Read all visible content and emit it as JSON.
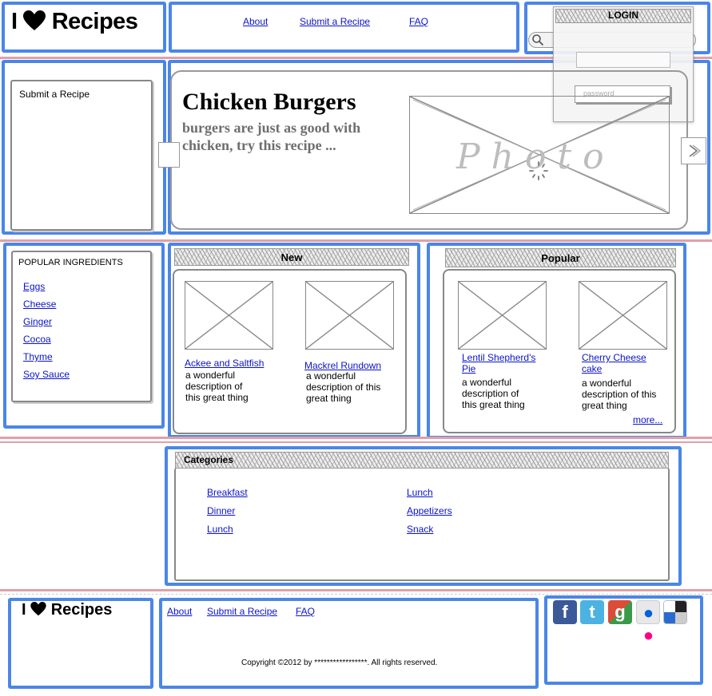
{
  "header": {
    "logo_prefix": "I",
    "logo_word": "Recipes",
    "nav": [
      {
        "label": "About"
      },
      {
        "label": "Submit a Recipe"
      },
      {
        "label": "FAQ"
      }
    ]
  },
  "login": {
    "title": "LOGIN",
    "password_placeholder": "password",
    "username_placeholder": ""
  },
  "side_panel": {
    "title": "Submit a Recipe"
  },
  "hero": {
    "title": "Chicken Burgers",
    "subtitle": "burgers are just as good with chicken, try this recipe ...",
    "photo_label": "Photo"
  },
  "ingredients": {
    "title": "POPULAR INGREDIENTS",
    "items": [
      "Eggs",
      "Cheese",
      "Ginger",
      "Cocoa",
      "Thyme",
      "Soy Sauce"
    ]
  },
  "new_section": {
    "title": "New",
    "items": [
      {
        "name": "Ackee and Saltfish",
        "desc": "a wonderful description of this great thing"
      },
      {
        "name": "Mackrel Rundown",
        "desc": "a wonderful description of this great thing"
      }
    ]
  },
  "popular_section": {
    "title": "Popular",
    "items": [
      {
        "name": "Lentil Shepherd's Pie",
        "desc": "a wonderful description of this great thing"
      },
      {
        "name": "Cherry Cheese cake",
        "desc": "a wonderful description of this great thing"
      }
    ],
    "more": "more..."
  },
  "categories": {
    "title": "Categories",
    "left": [
      "Breakfast",
      "Dinner",
      "Lunch"
    ],
    "right": [
      "Lunch",
      "Appetizers",
      "Snack"
    ]
  },
  "footer": {
    "logo_prefix": "I",
    "logo_word": "Recipes",
    "nav": [
      {
        "label": "About"
      },
      {
        "label": "Submit a Recipe"
      },
      {
        "label": "FAQ"
      }
    ],
    "copyright": "Copyright ©2012 by *****************. All rights reserved.",
    "social": [
      {
        "icon": "facebook-icon",
        "glyph": "f",
        "color": "#3b5998"
      },
      {
        "icon": "twitter-icon",
        "glyph": "t",
        "color": "#4bb3e2"
      },
      {
        "icon": "google-icon",
        "glyph": "g",
        "color": "#dd4b39"
      },
      {
        "icon": "flickr-icon",
        "glyph": "••",
        "color": "#e8e8e8"
      },
      {
        "icon": "delicious-icon",
        "glyph": "",
        "color": "#ffffff"
      }
    ]
  },
  "colors": {
    "frame": "#4a86e8",
    "divider": "#e0a0a8",
    "link": "#0b14c9"
  }
}
